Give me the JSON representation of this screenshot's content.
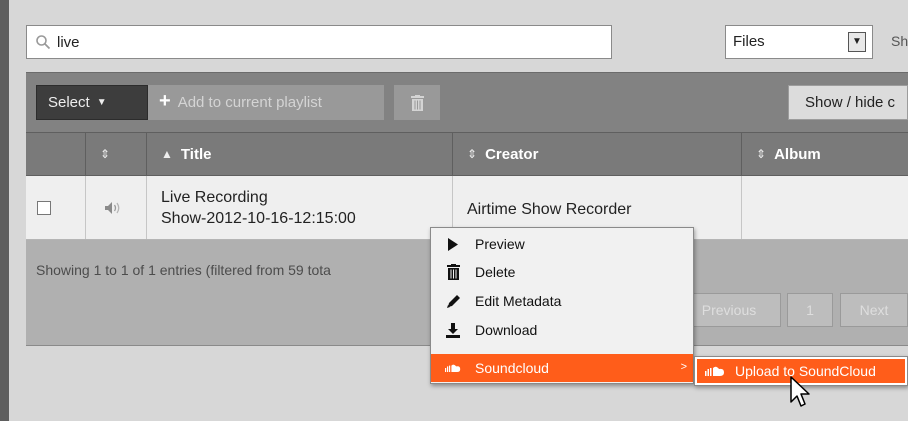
{
  "search": {
    "value": "live"
  },
  "type_filter": {
    "selected": "Files"
  },
  "cut_label": "Sh",
  "toolbar": {
    "select_label": "Select",
    "add_playlist_label": "Add to current playlist",
    "show_hide_label": "Show / hide c"
  },
  "table": {
    "columns": [
      "",
      "",
      "Title",
      "Creator",
      "Album"
    ],
    "rows": [
      {
        "title_line1": "Live Recording",
        "title_line2": "Show-2012-10-16-12:15:00",
        "creator": "Airtime Show Recorder",
        "album": ""
      }
    ]
  },
  "footer": {
    "info": "Showing 1 to 1 of 1 entries (filtered from 59 tota",
    "previous": "Previous",
    "page": "1",
    "next": "Next"
  },
  "context_menu": {
    "items": [
      {
        "label": "Preview",
        "icon": "play-icon"
      },
      {
        "label": "Delete",
        "icon": "trash-icon"
      },
      {
        "label": "Edit Metadata",
        "icon": "pencil-icon"
      },
      {
        "label": "Download",
        "icon": "download-icon"
      },
      {
        "label": "Soundcloud",
        "icon": "soundcloud-icon"
      }
    ]
  },
  "submenu": {
    "label": "Upload to SoundCloud",
    "icon": "soundcloud-icon"
  },
  "colors": {
    "accent": "#ff5d1a",
    "toolbar": "#828282",
    "header": "#7a7a7a"
  }
}
